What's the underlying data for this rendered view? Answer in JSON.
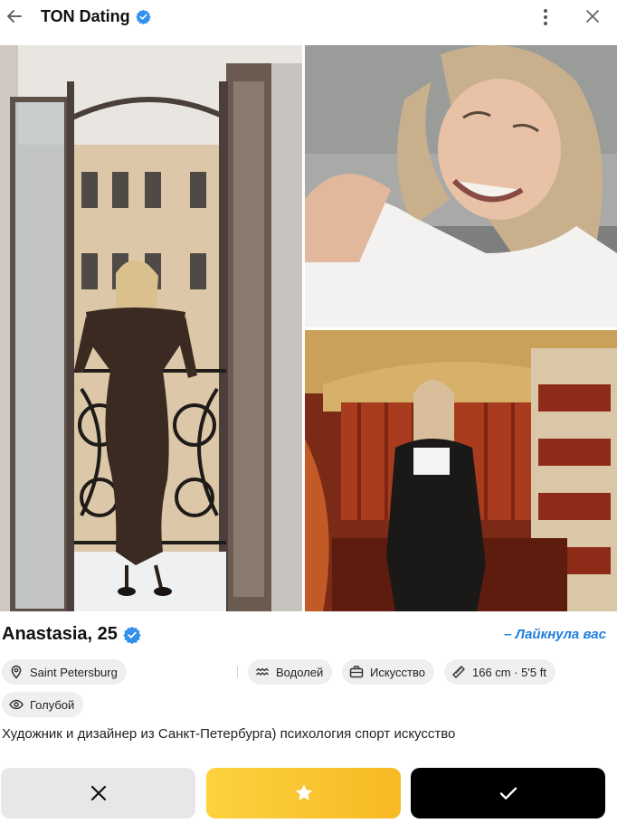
{
  "app": {
    "title": "TON Dating",
    "verified_icon": "verified-badge-icon",
    "accent": "#1f7ee0"
  },
  "header": {
    "back_icon": "arrow-left-icon",
    "menu_icon": "kebab-menu-icon",
    "close_icon": "close-icon"
  },
  "photos": [
    {
      "name": "photo-main",
      "description_icon": "photo"
    },
    {
      "name": "photo-top-right",
      "description_icon": "photo"
    },
    {
      "name": "photo-bottom-right",
      "description_icon": "photo"
    }
  ],
  "profile": {
    "name_age": "Anastasia, 25",
    "liked_label": "– Лайкнула вас",
    "chips": {
      "city": "Saint Petersburg",
      "zodiac": "Водолей",
      "interest": "Искусство",
      "height": "166 cm · 5'5 ft",
      "eyes": "Голубой"
    },
    "bio": "Художник и дизайнер из Санкт-Петербурга) психология спорт искусство"
  },
  "actions": {
    "dislike_icon": "x-icon",
    "superlike_icon": "star-icon",
    "like_icon": "checkmark-icon",
    "superlike_color": "#fdd13f",
    "like_color": "#000000"
  }
}
